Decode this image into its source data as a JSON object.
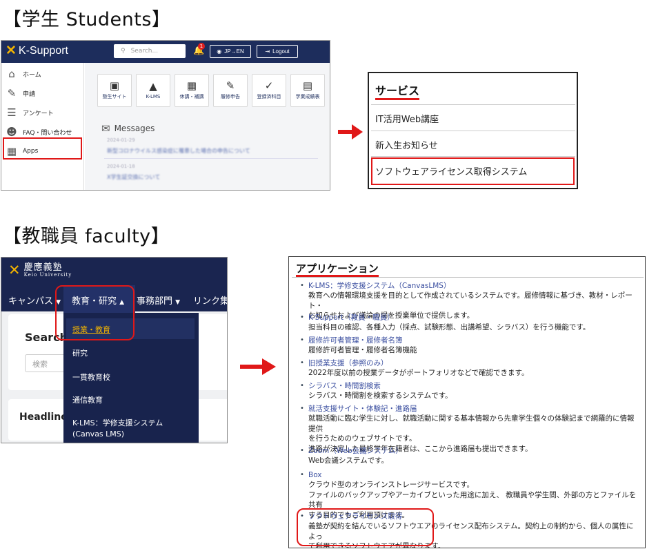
{
  "headings": {
    "students": "【学生  Students】",
    "faculty": "【教職員  faculty】"
  },
  "ksupport": {
    "logo": "K-Support",
    "search_placeholder": "Search...",
    "notification_count": "1",
    "lang_button": "JP→EN",
    "logout_button": "Logout",
    "sidebar": [
      {
        "label": "ホーム",
        "icon": "home-icon"
      },
      {
        "label": "申請",
        "icon": "application-icon"
      },
      {
        "label": "アンケート",
        "icon": "survey-icon"
      },
      {
        "label": "FAQ・問い合わせ",
        "icon": "faq-icon"
      },
      {
        "label": "Apps",
        "icon": "apps-grid-icon"
      }
    ],
    "tiles": [
      {
        "label": "塾生サイト",
        "icon": "monitor-icon"
      },
      {
        "label": "K-LMS",
        "icon": "graduation-cap-icon"
      },
      {
        "label": "休講・補講",
        "icon": "calendar-icon"
      },
      {
        "label": "履修申告",
        "icon": "pencil-icon"
      },
      {
        "label": "登録済科目",
        "icon": "check-icon"
      },
      {
        "label": "学業成績表",
        "icon": "report-icon"
      }
    ],
    "messages_title": "Messages",
    "messages": [
      {
        "date": "2024-01-29",
        "title": "新型コロナウイルス感染症に罹患した場合の申告について"
      },
      {
        "date": "2024-01-18",
        "title": "X学生証交換について"
      }
    ]
  },
  "services": {
    "title": "サービス",
    "items": [
      "IT活用Web講座",
      "新入生お知らせ",
      "ソフトウェアライセンス取得システム"
    ]
  },
  "keio": {
    "logo_jp": "慶應義塾",
    "logo_en": "Keio University",
    "nav": [
      "キャンパス",
      "教育・研究",
      "事務部門",
      "リンク集"
    ],
    "search_title": "Search",
    "search_placeholder": "検索",
    "headline": "Headline",
    "dropdown": [
      "授業・教育",
      "研究",
      "一貫教育校",
      "通信教育",
      "K-LMS：学修支援システム (Canvas LMS)"
    ]
  },
  "applications": {
    "title": "アプリケーション",
    "entries": [
      {
        "link": "K-LMS：学修支援システム（CanvasLMS）",
        "desc": [
          "教育への情報環境支援を目的として作成されているシステムです。履修情報に基づき、教材・レポート・",
          "お知らせおよび議論の場を授業単位で提供します。"
        ]
      },
      {
        "link": "K-Support（教員・職員）",
        "desc": [
          "担当科目の確認、各種入力（採点、試験形態、出講希望、シラバス）を行う機能です。"
        ]
      },
      {
        "link": "履修許可者管理・履修者名簿",
        "desc": [
          "履修許可者管理・履修者名簿機能"
        ]
      },
      {
        "link": "旧授業支援（参照のみ）",
        "desc": [
          "2022年度以前の授業データがポートフォリオなどで確認できます。"
        ]
      },
      {
        "link": "シラバス・時間割検索",
        "desc": [
          "シラバス・時間割を検索するシステムです。"
        ]
      },
      {
        "link": "就活支援サイト・体験記・進路届",
        "desc": [
          "就職活動に臨む学生に対し、就職活動に関する基本情報から先輩学生個々の体験記まで網羅的に情報提供",
          "を行うためのウェブサイトです。",
          "進路が決定した最終学年在籍者は、ここから進路届も提出できます。"
        ]
      },
      {
        "link": "Zoom（Web会議システム）",
        "desc": [
          "Web会議システムです。"
        ]
      },
      {
        "link": "Box",
        "desc": [
          "クラウド型のオンラインストレージサービスです。",
          "ファイルのバックアップやアーカイブといった用途に加え、 教職員や学生間、外部の方とファイルを共有",
          "する目的でもご利用頂けます。"
        ]
      },
      {
        "link": "ソフトウェアライセンス取得",
        "desc": [
          "義塾が契約を結んでいるソフトウエアのライセンス配布システム。契約上の制約から、個人の属性によっ",
          "て利用できるソフトウエアが異なります。"
        ]
      }
    ]
  },
  "colors": {
    "navy": "#1d2d5c",
    "highlight_red": "#e01818",
    "keio_gold": "#f3b400",
    "link_blue": "#3b4fa0"
  }
}
